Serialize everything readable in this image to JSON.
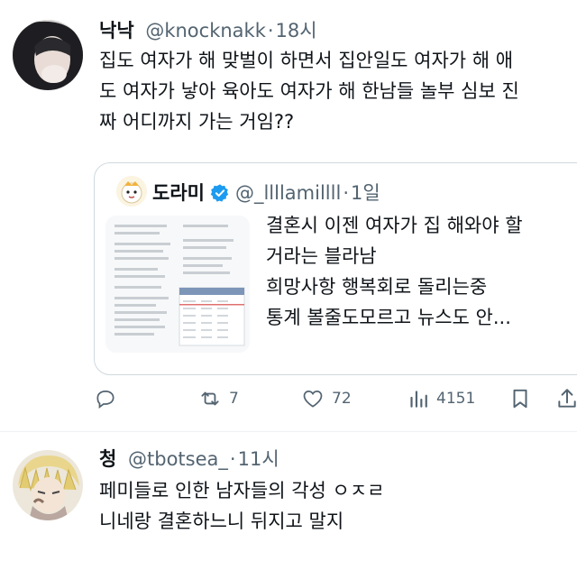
{
  "tweet1": {
    "display_name": "낙낙",
    "handle": "@knocknakk",
    "separator": "·",
    "time": "18시",
    "text": "집도 여자가 해 맞벌이 하면서 집안일도 여자가 해 애\n도 여자가 낳아 육아도 여자가 해 한남들 놀부 심보 진\n짜 어디까지 가는 거임??",
    "quote": {
      "display_name": "도라미",
      "handle": "@_llllamillll",
      "separator": "·",
      "time": "1일",
      "text": "결혼시 이젠 여자가 집 해와야 할\n거라는 블라남\n희망사항 행복회로 돌리는중\n통계 볼줄도모르고 뉴스도 안..."
    },
    "actions": {
      "reply_count": "",
      "retweet_count": "7",
      "like_count": "72",
      "view_count": "4151"
    }
  },
  "tweet2": {
    "display_name": "청",
    "handle": "@tbotsea_",
    "separator": "·",
    "time": "11시",
    "text": "페미들로 인한 남자들의 각성 ㅇㅈㄹ\n니네랑 결혼하느니 뒤지고 말지"
  },
  "colors": {
    "text": "#0f1419",
    "muted": "#536471",
    "border": "#cfd9de",
    "verified": "#1d9bf0"
  }
}
